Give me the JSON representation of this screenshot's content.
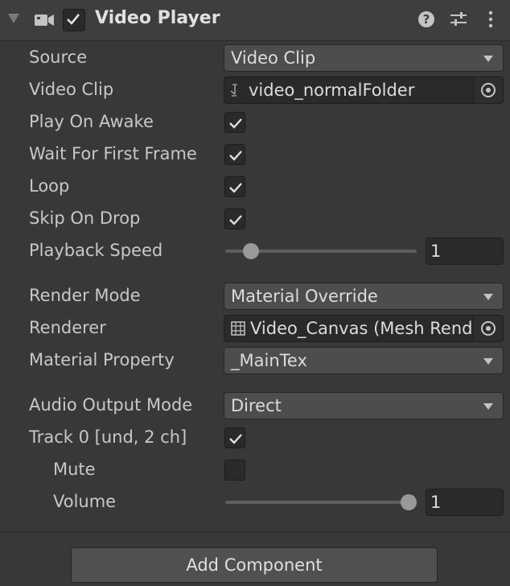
{
  "header": {
    "title": "Video Player",
    "enabled": true,
    "icons": [
      "foldout-arrow-icon",
      "video-camera-icon",
      "help-icon",
      "preset-sliders-icon",
      "more-vert-icon"
    ]
  },
  "fields": {
    "source": {
      "label": "Source",
      "value": "Video Clip"
    },
    "video_clip": {
      "label": "Video Clip",
      "value": "video_normalFolder"
    },
    "play_on_awake": {
      "label": "Play On Awake",
      "checked": true
    },
    "wait_first_frame": {
      "label": "Wait For First Frame",
      "checked": true
    },
    "loop": {
      "label": "Loop",
      "checked": true
    },
    "skip_on_drop": {
      "label": "Skip On Drop",
      "checked": true
    },
    "playback_speed": {
      "label": "Playback Speed",
      "value": "1",
      "slider_fraction": 0.1
    },
    "render_mode": {
      "label": "Render Mode",
      "value": "Material Override"
    },
    "renderer": {
      "label": "Renderer",
      "value": "Video_Canvas (Mesh Renderer)"
    },
    "material_property": {
      "label": "Material Property",
      "value": "_MainTex"
    },
    "audio_output_mode": {
      "label": "Audio Output Mode",
      "value": "Direct"
    },
    "track0": {
      "label": "Track 0 [und, 2 ch]",
      "checked": true
    },
    "mute": {
      "label": "Mute",
      "checked": false
    },
    "volume": {
      "label": "Volume",
      "value": "1",
      "slider_fraction": 1.0
    }
  },
  "add_component_label": "Add Component"
}
